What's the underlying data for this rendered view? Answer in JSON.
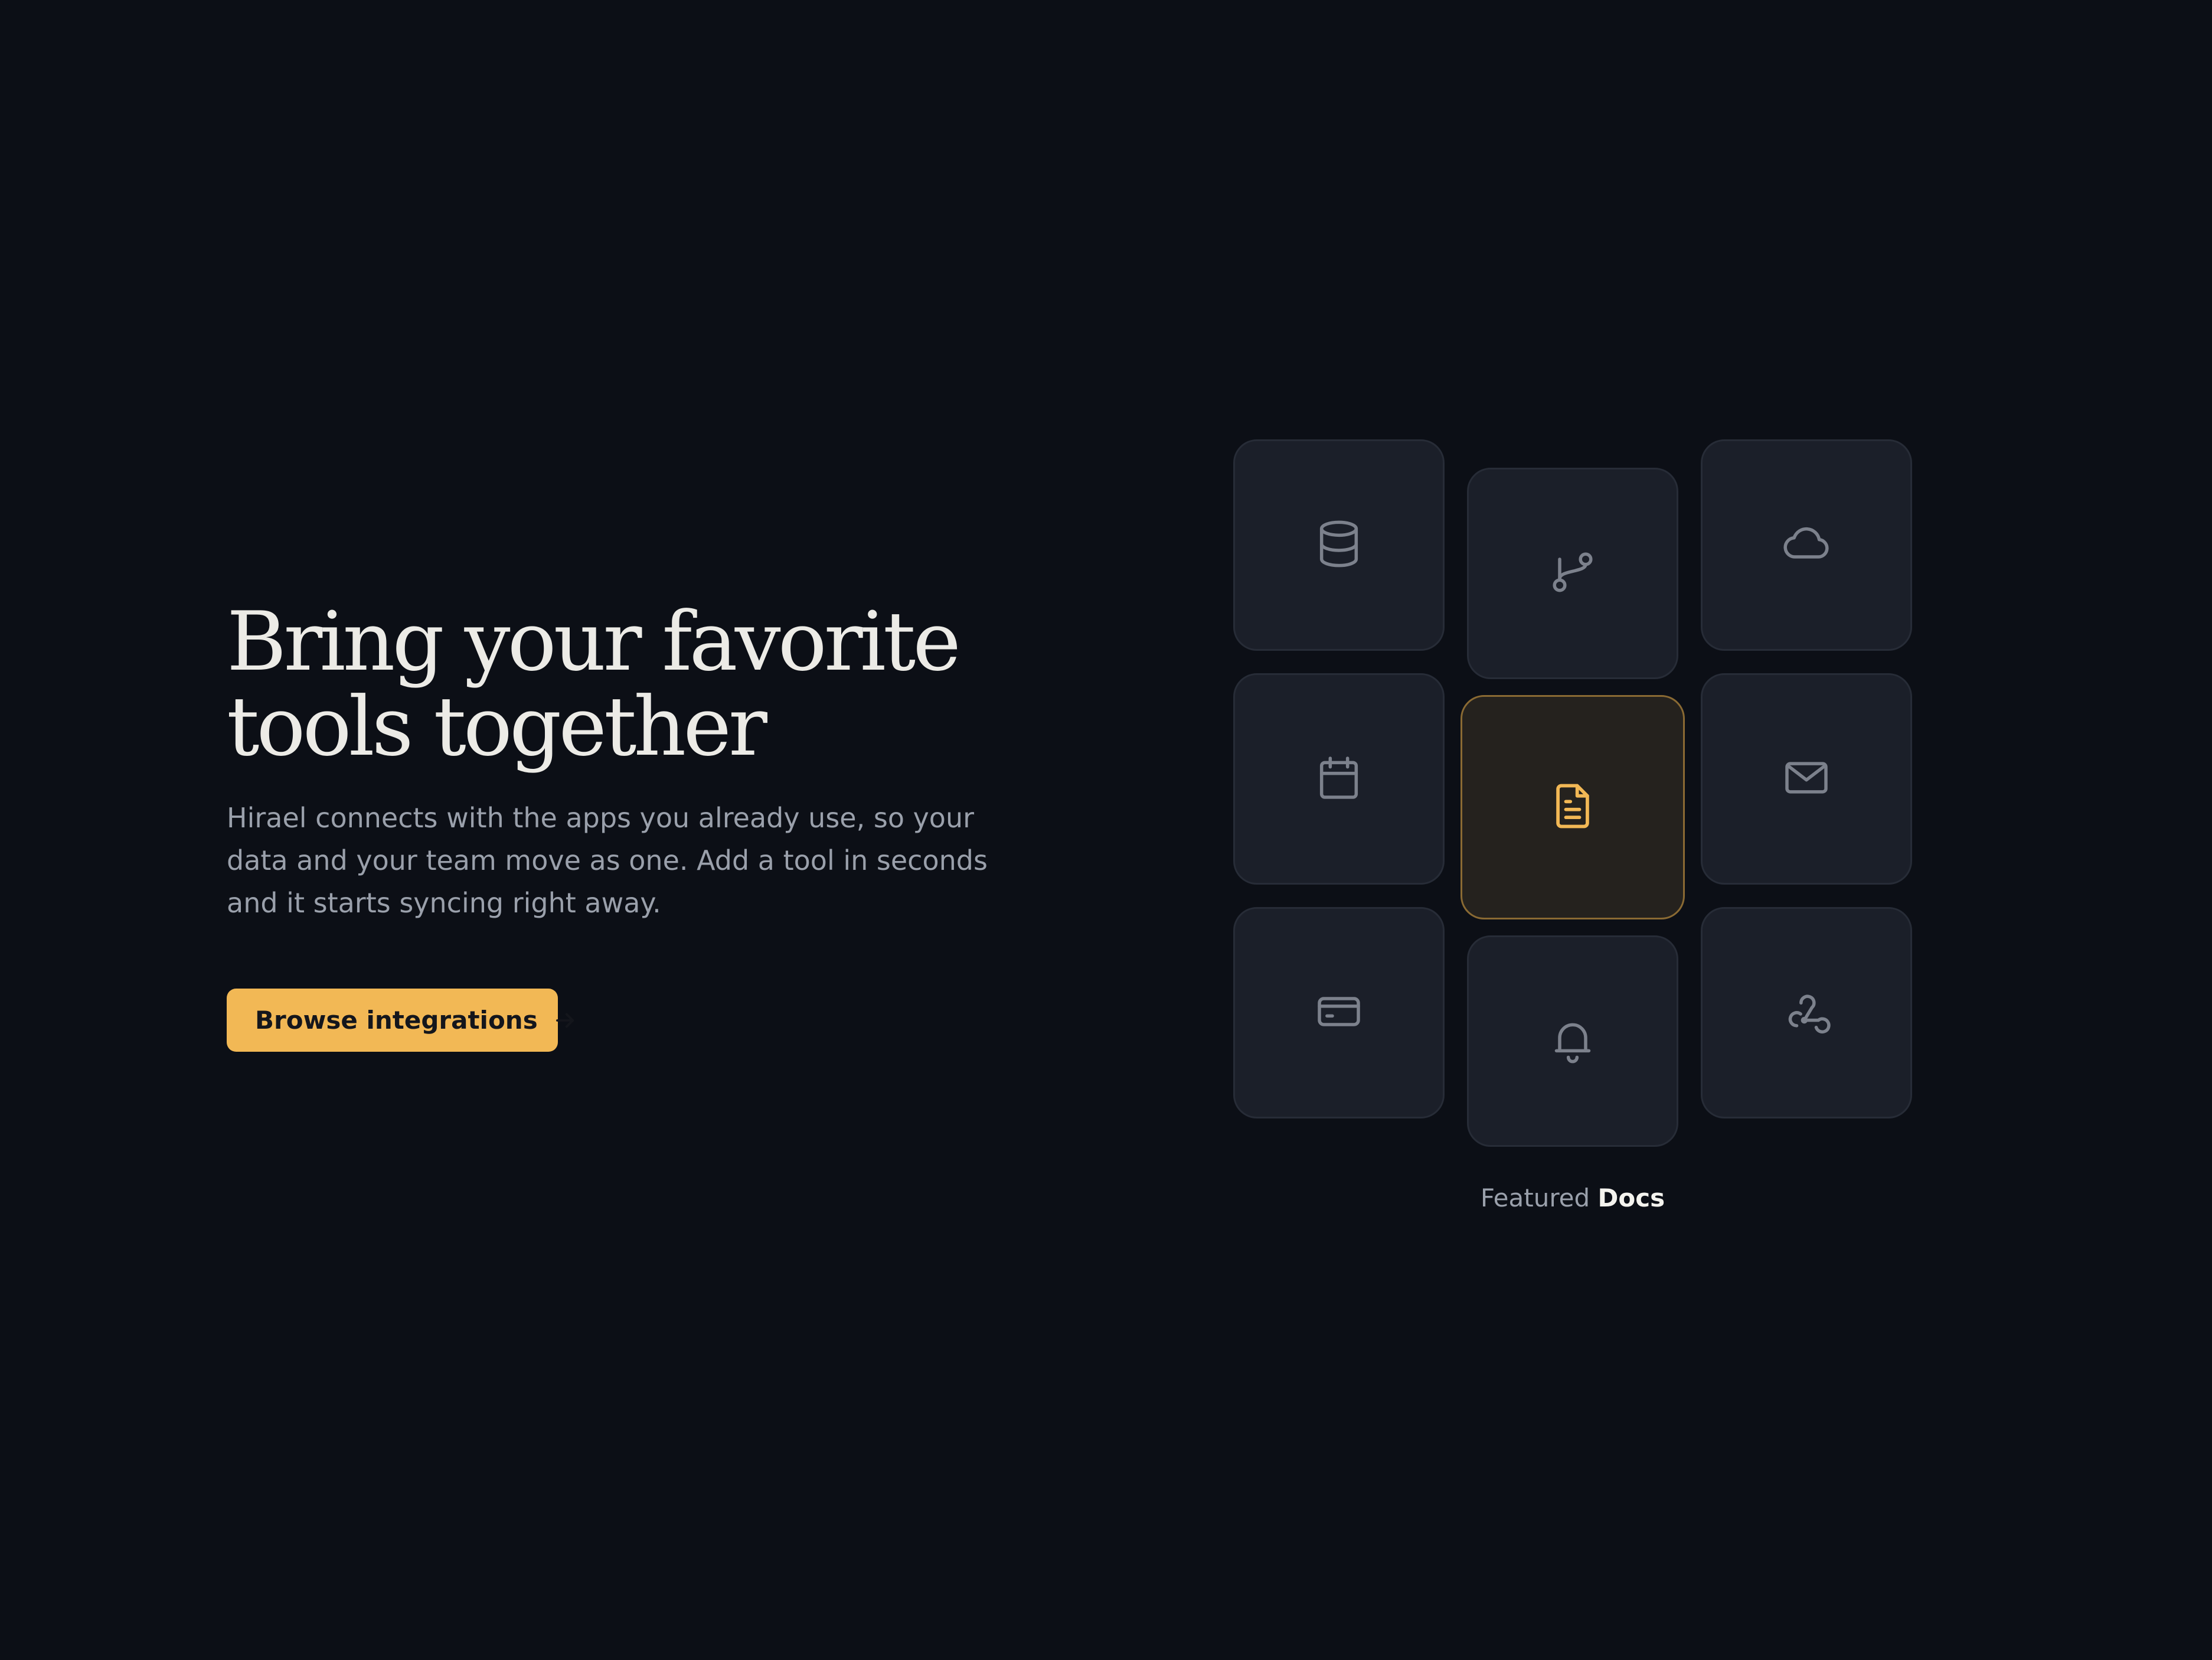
{
  "hero": {
    "headline_line1": "Bring your favorite",
    "headline_line2": "tools together",
    "subtitle": "Hirael connects with the apps you already use, so your data and your team move as one. Add a tool in seconds and it starts syncing right away.",
    "cta_label": "Browse integrations",
    "cta_icon": "arrow-right-icon"
  },
  "integrations": {
    "tiles": [
      {
        "icon": "database-icon"
      },
      {
        "icon": "git-branch-icon"
      },
      {
        "icon": "cloud-icon"
      },
      {
        "icon": "calendar-icon"
      },
      {
        "icon": "document-icon",
        "featured": true
      },
      {
        "icon": "mail-icon"
      },
      {
        "icon": "credit-card-icon"
      },
      {
        "icon": "bell-icon"
      },
      {
        "icon": "webhook-icon"
      }
    ],
    "caption_prefix": "Featured",
    "caption_featured": "Docs"
  },
  "colors": {
    "background": "#0c0f16",
    "accent": "#f2b855",
    "tile_bg": "#1b1f29",
    "featured_tile_bg": "#25221e",
    "headline": "#ecebe6",
    "muted_text": "#9aa0ab"
  }
}
